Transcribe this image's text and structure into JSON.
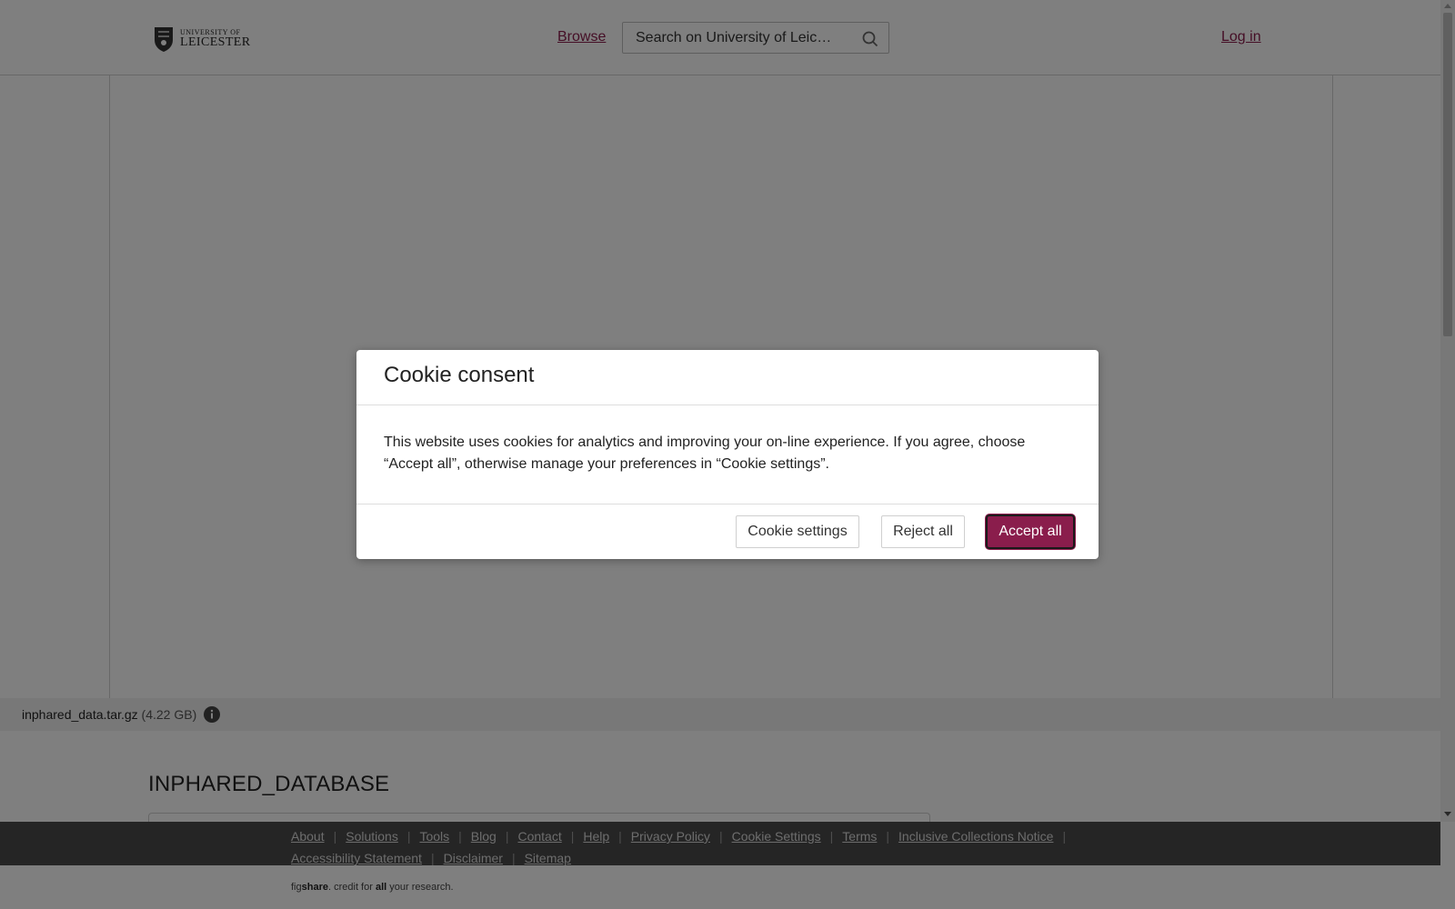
{
  "header": {
    "logo_top": "UNIVERSITY OF",
    "logo_main": "LEICESTER",
    "browse_label": "Browse",
    "search_placeholder": "Search on University of Leic…",
    "login_label": "Log in"
  },
  "file": {
    "name": "inphared_data.tar.gz",
    "size": "(4.22 GB)"
  },
  "dataset": {
    "title": "INPHARED_DATABASE"
  },
  "footer": {
    "row1": [
      "About",
      "Solutions",
      "Tools",
      "Blog",
      "Contact",
      "Help",
      "Privacy Policy",
      "Cookie Settings",
      "Terms",
      "Inclusive Collections Notice"
    ],
    "row2": [
      "Accessibility Statement",
      "Disclaimer",
      "Sitemap"
    ],
    "tagline": {
      "fig": "fig",
      "share": "share",
      "mid": ". credit for ",
      "all": "all",
      "end": " your research."
    }
  },
  "modal": {
    "title": "Cookie consent",
    "body": "This website uses cookies for analytics and improving your on-line experience. If you agree, choose “Accept all”, otherwise manage your preferences in “Cookie settings”.",
    "settings_label": "Cookie settings",
    "reject_label": "Reject all",
    "accept_label": "Accept all"
  },
  "colors": {
    "brand": "#8a1d4c",
    "footer_dark": "#4a4a4a"
  },
  "icons": {
    "logo": "shield-crest-icon",
    "search": "search-icon",
    "info": "info-icon"
  }
}
